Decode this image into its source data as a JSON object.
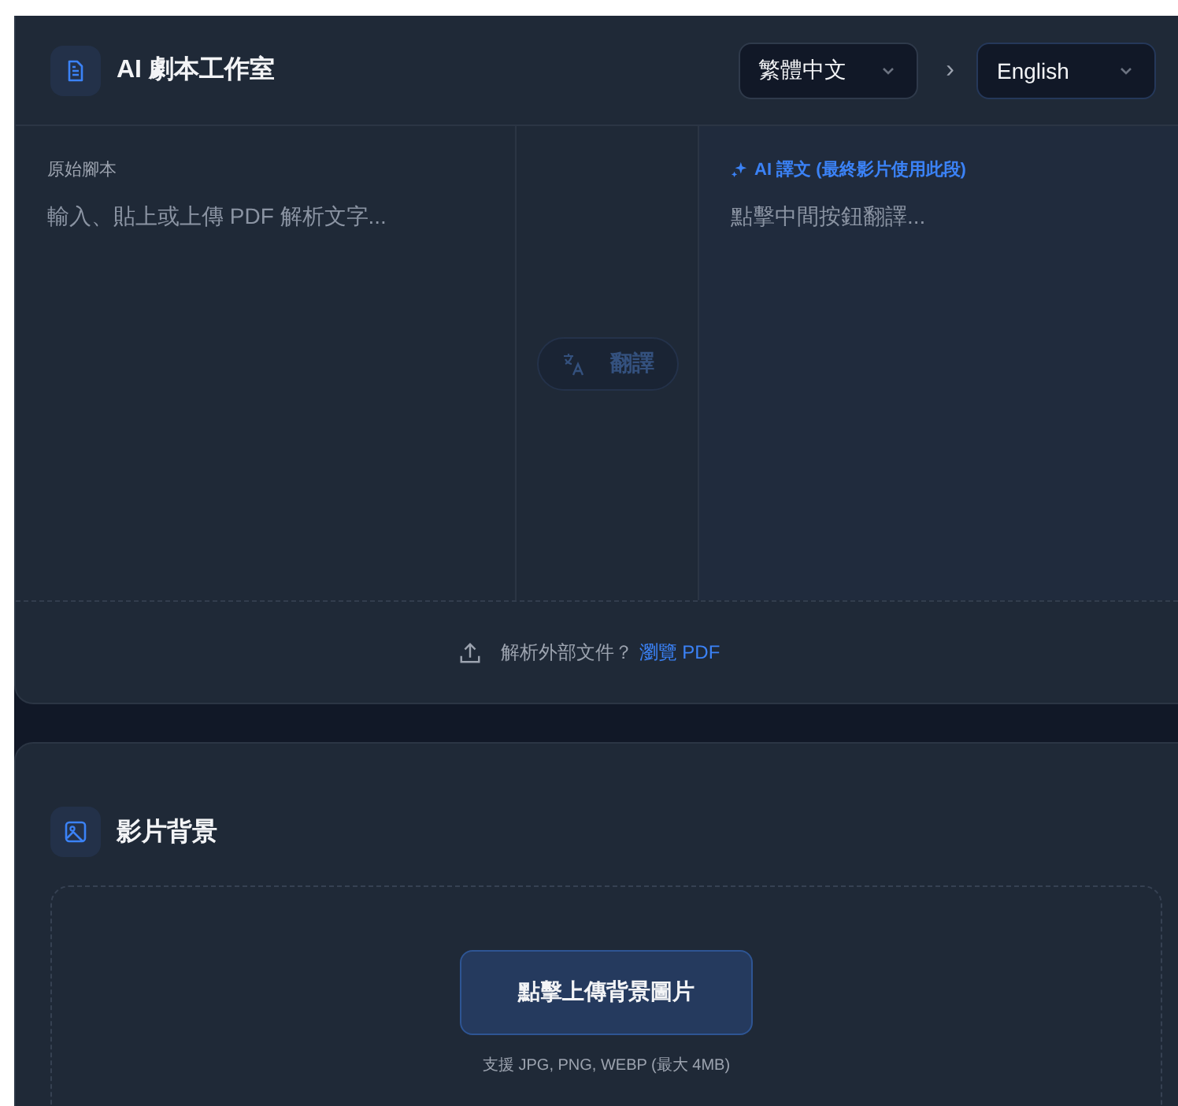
{
  "header": {
    "title": "AI 劇本工作室",
    "source_language": "繁體中文",
    "separator": "›",
    "target_language": "English"
  },
  "editor": {
    "source_label": "原始腳本",
    "source_placeholder": "輸入、貼上或上傳 PDF 解析文字...",
    "translate_button": {
      "label": "翻譯",
      "disabled": true
    },
    "output_label": "AI 譯文 (最終影片使用此段)",
    "output_placeholder": "點擊中間按鈕翻譯...",
    "pdf_prompt": "解析外部文件？",
    "pdf_link": "瀏覽 PDF"
  },
  "background": {
    "title": "影片背景",
    "upload_button": "點擊上傳背景圖片",
    "hint": "支援 JPG, PNG, WEBP (最大 4MB)"
  }
}
